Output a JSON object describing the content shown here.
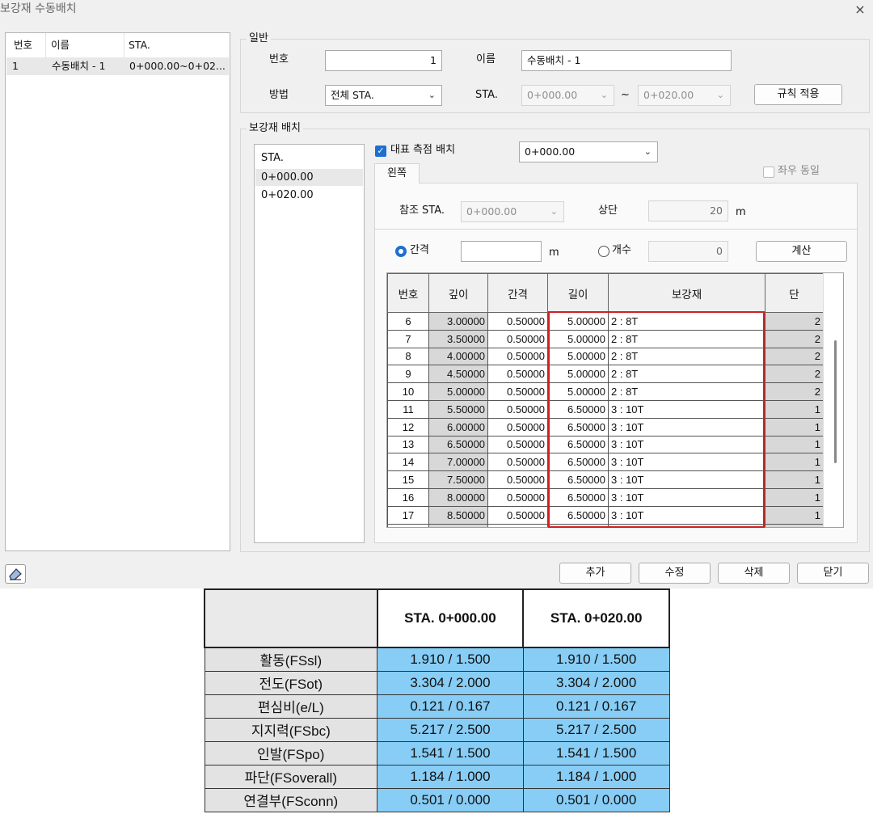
{
  "window": {
    "title": "보강재 수동배치",
    "close_icon": "×"
  },
  "list": {
    "headers": [
      "번호",
      "이름",
      "STA."
    ],
    "rows": [
      {
        "no": "1",
        "name": "수동배치 - 1",
        "sta": "0+000.00~0+02..."
      }
    ]
  },
  "general": {
    "legend": "일반",
    "number_label": "번호",
    "number_value": "1",
    "name_label": "이름",
    "name_value": "수동배치 - 1",
    "method_label": "방법",
    "method_value": "전체 STA.",
    "sta_label": "STA.",
    "sta_from": "0+000.00",
    "tilde": "~",
    "sta_to": "0+020.00",
    "apply_rule_button": "규칙 적용"
  },
  "placement": {
    "legend": "보강재 배치",
    "sta_list_header": "STA.",
    "sta_items": [
      "0+000.00",
      "0+020.00"
    ],
    "rep_point_label": "대표 측점 배치",
    "rep_point_checked": true,
    "rep_point_value": "0+000.00",
    "tab_left": "왼쪽",
    "same_lr_label": "좌우 동일",
    "ref_sta_label": "참조 STA.",
    "ref_sta_value": "0+000.00",
    "top_label": "상단",
    "top_value": "20",
    "top_unit": "m",
    "interval_label": "간격",
    "interval_value": "",
    "interval_unit": "m",
    "count_label": "개수",
    "count_value": "0",
    "calc_button": "계산"
  },
  "grid": {
    "columns": [
      "번호",
      "깊이",
      "간격",
      "길이",
      "보강재",
      "단"
    ],
    "rows": [
      [
        "6",
        "3.00000",
        "0.50000",
        "5.00000",
        "2 : 8T",
        "2"
      ],
      [
        "7",
        "3.50000",
        "0.50000",
        "5.00000",
        "2 : 8T",
        "2"
      ],
      [
        "8",
        "4.00000",
        "0.50000",
        "5.00000",
        "2 : 8T",
        "2"
      ],
      [
        "9",
        "4.50000",
        "0.50000",
        "5.00000",
        "2 : 8T",
        "2"
      ],
      [
        "10",
        "5.00000",
        "0.50000",
        "5.00000",
        "2 : 8T",
        "2"
      ],
      [
        "11",
        "5.50000",
        "0.50000",
        "6.50000",
        "3 : 10T",
        "1"
      ],
      [
        "12",
        "6.00000",
        "0.50000",
        "6.50000",
        "3 : 10T",
        "1"
      ],
      [
        "13",
        "6.50000",
        "0.50000",
        "6.50000",
        "3 : 10T",
        "1"
      ],
      [
        "14",
        "7.00000",
        "0.50000",
        "6.50000",
        "3 : 10T",
        "1"
      ],
      [
        "15",
        "7.50000",
        "0.50000",
        "6.50000",
        "3 : 10T",
        "1"
      ],
      [
        "16",
        "8.00000",
        "0.50000",
        "6.50000",
        "3 : 10T",
        "1"
      ],
      [
        "17",
        "8.50000",
        "0.50000",
        "6.50000",
        "3 : 10T",
        "1"
      ]
    ]
  },
  "footer": {
    "eraser_icon": "eraser-icon",
    "add_button": "추가",
    "modify_button": "수정",
    "delete_button": "삭제",
    "close_button": "닫기"
  },
  "results": {
    "headers": [
      "STA. 0+000.00",
      "STA. 0+020.00"
    ],
    "rows": [
      {
        "label": "활동(FSsl)",
        "v1": "1.910 / 1.500",
        "v2": "1.910 / 1.500"
      },
      {
        "label": "전도(FSot)",
        "v1": "3.304 / 2.000",
        "v2": "3.304 / 2.000"
      },
      {
        "label": "편심비(e/L)",
        "v1": "0.121 / 0.167",
        "v2": "0.121 / 0.167"
      },
      {
        "label": "지지력(FSbc)",
        "v1": "5.217 / 2.500",
        "v2": "5.217 / 2.500"
      },
      {
        "label": "인발(FSpo)",
        "v1": "1.541 / 1.500",
        "v2": "1.541 / 1.500"
      },
      {
        "label": "파단(FSoverall)",
        "v1": "1.184 / 1.000",
        "v2": "1.184 / 1.000"
      },
      {
        "label": "연결부(FSconn)",
        "v1": "0.501 / 0.000",
        "v2": "0.501 / 0.000"
      }
    ]
  },
  "colors": {
    "accent": "#1f6fd0",
    "highlight_box": "#d02020",
    "result_cell": "#87cdf5"
  }
}
